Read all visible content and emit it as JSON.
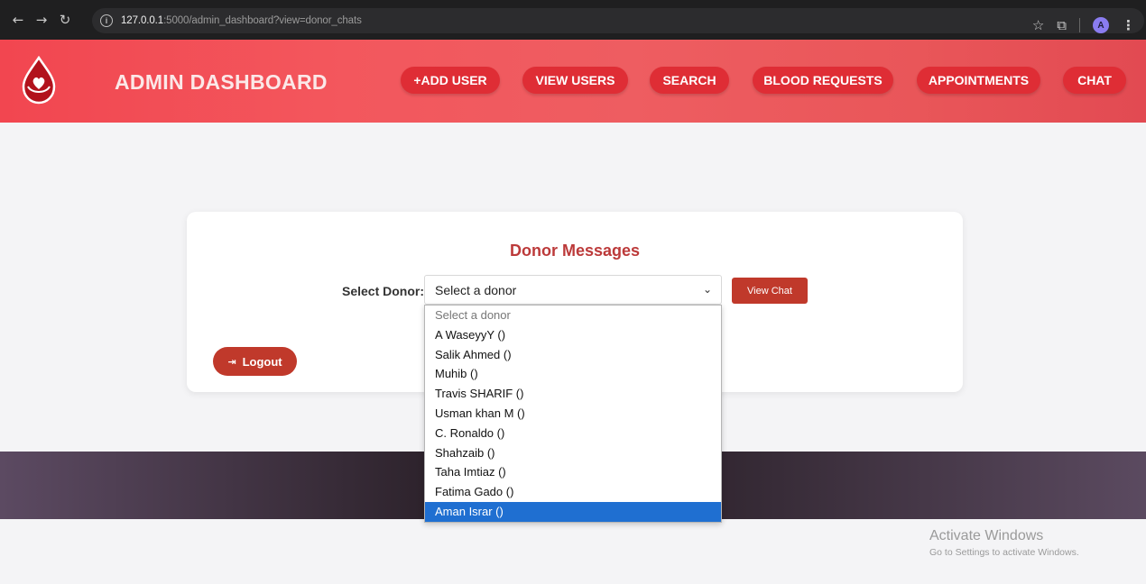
{
  "browser": {
    "url_host": "127.0.0.1",
    "url_rest": ":5000/admin_dashboard?view=donor_chats",
    "profile_initial": "A"
  },
  "header": {
    "title": "ADMIN DASHBOARD",
    "nav": {
      "add_user": "+ADD USER",
      "view_users": "VIEW USERS",
      "search": "SEARCH",
      "blood_requests": "BLOOD REQUESTS",
      "appointments": "APPOINTMENTS",
      "chat": "CHAT"
    },
    "accent_color": "#df2d35"
  },
  "donor_messages": {
    "title": "Donor Messages",
    "select_label": "Select Donor:",
    "selected_value": "Select a donor",
    "view_chat_label": "View Chat",
    "options": [
      "Select a donor",
      "A WaseyyY ()",
      "Salik Ahmed ()",
      "Muhib ()",
      "Travis SHARIF ()",
      "Usman khan M ()",
      "C. Ronaldo ()",
      "Shahzaib ()",
      "Taha Imtiaz ()",
      "Fatima Gado ()",
      "Aman Israr ()"
    ],
    "highlighted_option": "Aman Israr ()"
  },
  "logout": {
    "label": "Logout"
  },
  "watermark": {
    "title": "Activate Windows",
    "subtitle": "Go to Settings to activate Windows."
  }
}
